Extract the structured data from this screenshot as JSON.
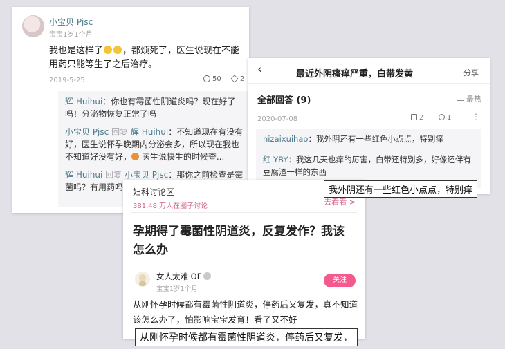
{
  "card1": {
    "username": "小宝贝 Pjsc",
    "user_meta": "宝宝1岁1个月",
    "comment_part1": "我也是这样子",
    "comment_part2": "，都烦死了，医生说现在不能用药只能等生了之后治疗。",
    "date": "2019-5-25",
    "comment_count": "50",
    "like_count": "2",
    "replies": [
      {
        "name": "辉 Huihui",
        "text": "：你也有霉菌性阴道炎吗？现在好了吗！分泌物恢复正常了吗"
      },
      {
        "name": "小宝贝 Pjsc",
        "reply_word": " 回复 ",
        "target": "辉 Huihui",
        "text_part1": "：不知道现在有没有好，医生说怀孕晚期内分泌会多，所以现在我也不知道好没有好，",
        "text_part2": " 医生说快生的时候查..."
      },
      {
        "name": "辉 Huihui",
        "reply_word": " 回复 ",
        "target": "小宝贝 Pjsc",
        "text": "：那你之前检查是霉菌吗？有用药吗"
      }
    ]
  },
  "card2": {
    "back_icon": "‹",
    "title": "最近外阴瘙痒严重，白带发黄",
    "share": "分享",
    "all_answers": "全部回答 (9)",
    "sort": "最热",
    "date": "2020-07-08",
    "comment_count": "2",
    "like_count": "1",
    "more_icon": "⋮",
    "answers": [
      {
        "name": "nizaixuihao",
        "text": "：我外阴还有一些红色小点点，特别痒"
      },
      {
        "name": "红 YBY",
        "text": "：我这几天也痒的厉害，白带还特别多，好像还伴有豆腐渣一样的东西"
      }
    ]
  },
  "card3": {
    "circle_name": "妇科讨论区",
    "members": "381.48 万人在圈子讨论",
    "go_view": "去看看 >",
    "question": "孕期得了霉菌性阴道炎，反复发作？我该怎么办",
    "author": "女人太难 OF",
    "author_meta": "宝宝1岁1个月",
    "follow": "关注",
    "body": "从刚怀孕时候都有霉菌性阴道炎，停药后又复发，真不知道该怎么办了，怕影响宝宝发育！看了又不好"
  },
  "captions": {
    "caption1": "我外阴还有一些红色小点点，特别痒",
    "caption2": "从刚怀孕时候都有霉菌性阴道炎，停药后又复发，"
  },
  "colors": {
    "name_teal": "#4a7a8c",
    "pink_accent": "#d2638a",
    "follow_button": "#f55a8e"
  }
}
